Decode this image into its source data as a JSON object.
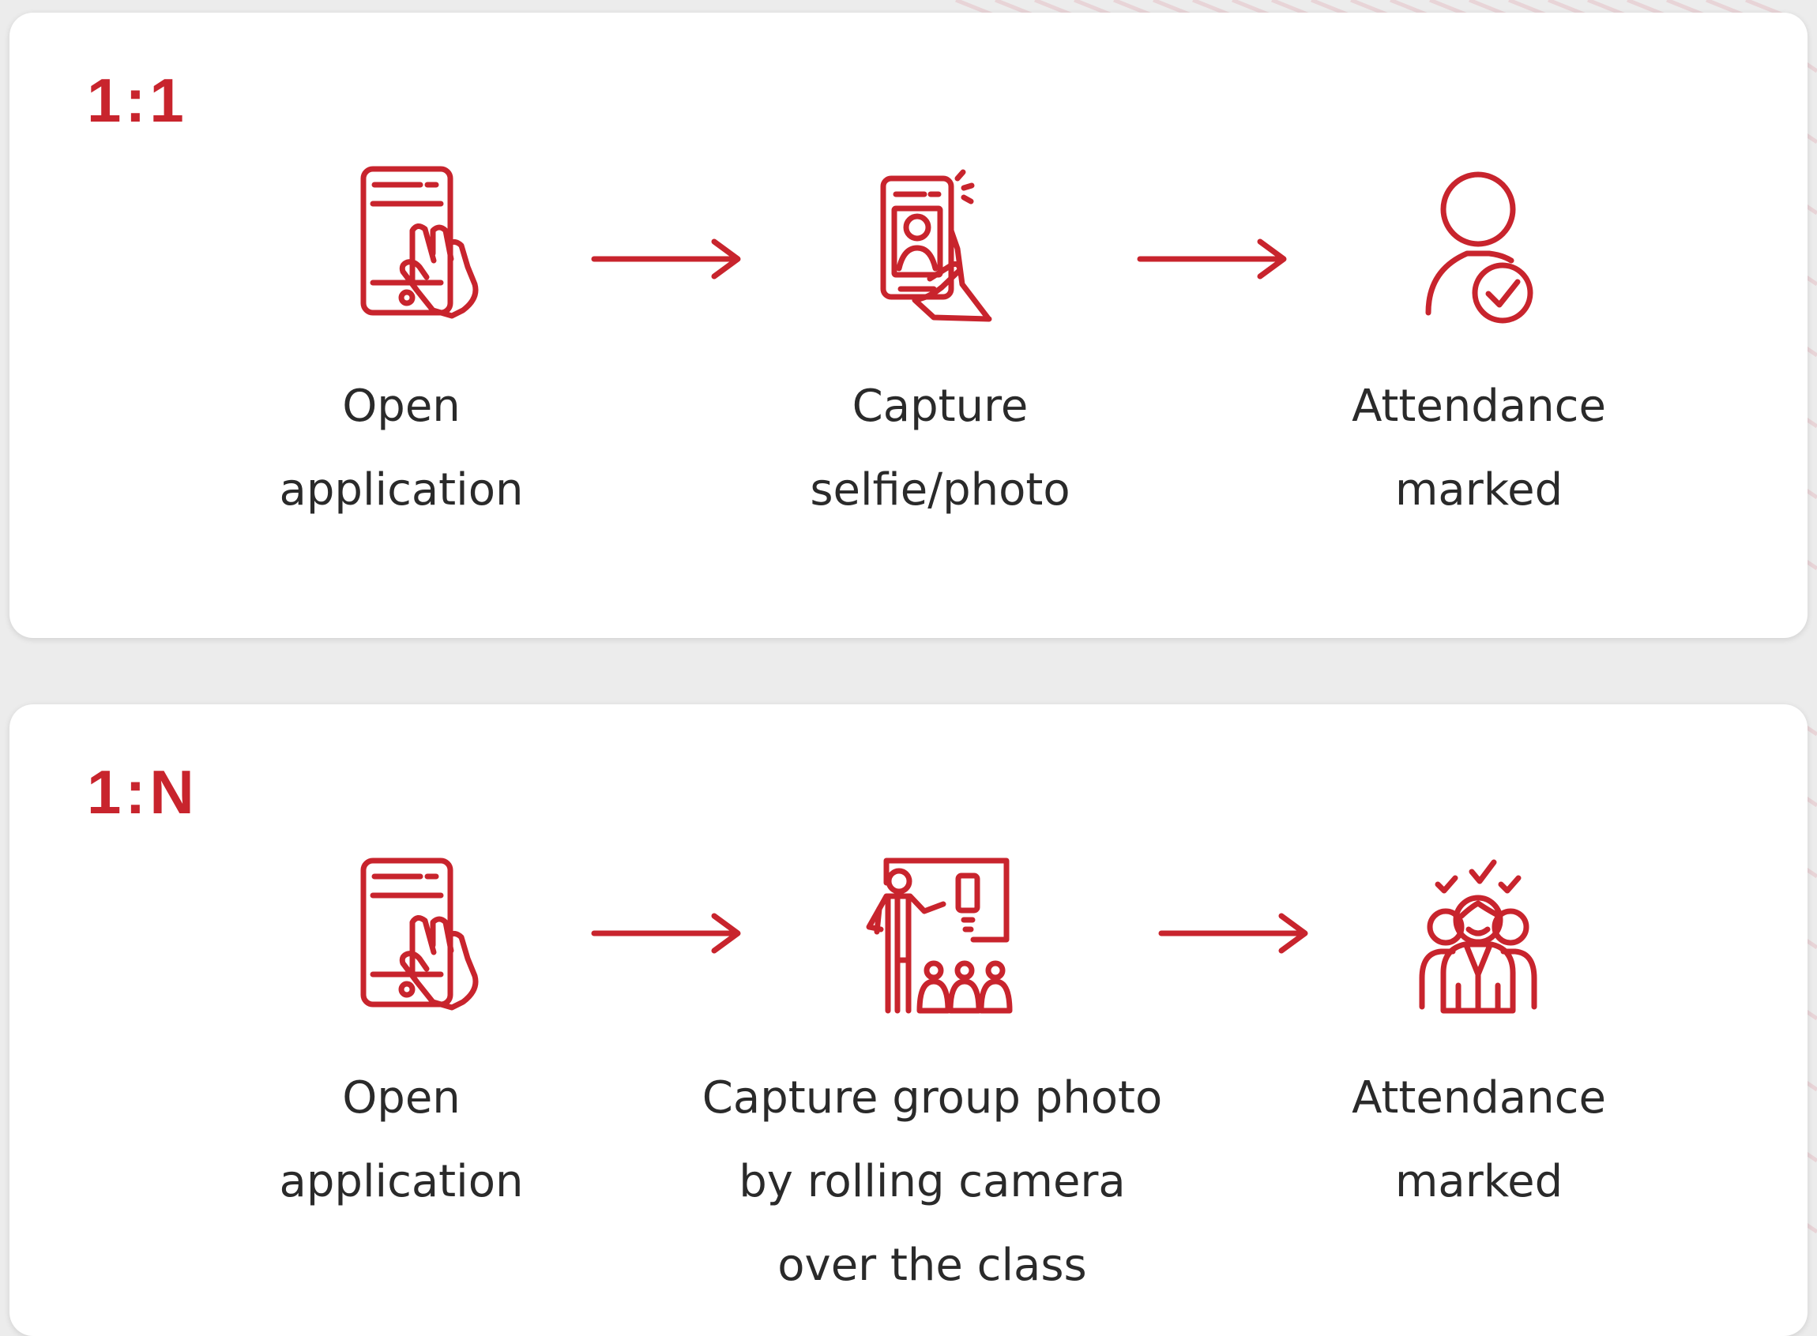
{
  "colors": {
    "accent": "#c8242d",
    "panel_background": "#ffffff",
    "page_background": "#ececec",
    "text": "#2a2a2a"
  },
  "flows": [
    {
      "title": "1:1",
      "steps": [
        {
          "icon": "phone-touch-icon",
          "label": "Open\napplication"
        },
        {
          "icon": "selfie-photo-icon",
          "label": "Capture\nselfie/photo"
        },
        {
          "icon": "person-check-icon",
          "label": "Attendance\nmarked"
        }
      ]
    },
    {
      "title": "1:N",
      "steps": [
        {
          "icon": "phone-touch-icon",
          "label": "Open\napplication"
        },
        {
          "icon": "classroom-presentation-icon",
          "label": "Capture group photo\nby rolling camera\nover the class"
        },
        {
          "icon": "group-check-icon",
          "label": "Attendance\nmarked"
        }
      ]
    }
  ]
}
